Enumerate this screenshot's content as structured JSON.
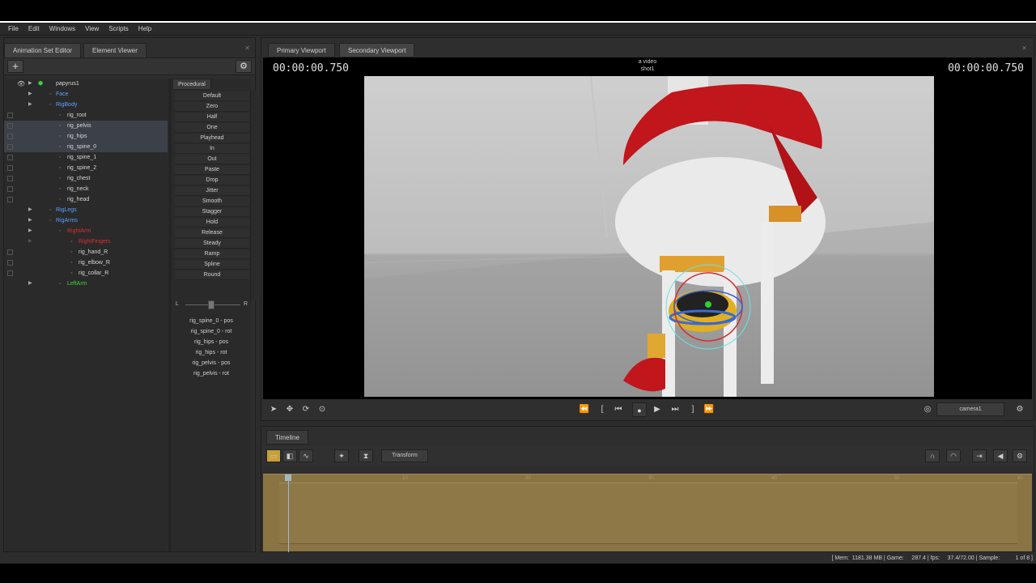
{
  "menu": [
    "File",
    "Edit",
    "Windows",
    "View",
    "Scripts",
    "Help"
  ],
  "left_tabs": [
    "Animation Set Editor",
    "Element Viewer"
  ],
  "tree": [
    {
      "label": "papyrus1",
      "color": "#d6d6d6"
    },
    {
      "label": "Face",
      "color": "#5aa0ff"
    },
    {
      "label": "RigBody",
      "color": "#5aa0ff"
    },
    {
      "label": "rig_root",
      "color": "#d6d6d6"
    },
    {
      "label": "rig_pelvis",
      "color": "#d6d6d6"
    },
    {
      "label": "rig_hips",
      "color": "#d6d6d6"
    },
    {
      "label": "rig_spine_0",
      "color": "#d6d6d6"
    },
    {
      "label": "rig_spine_1",
      "color": "#d6d6d6"
    },
    {
      "label": "rig_spine_2",
      "color": "#d6d6d6"
    },
    {
      "label": "rig_chest",
      "color": "#d6d6d6"
    },
    {
      "label": "rig_neck",
      "color": "#d6d6d6"
    },
    {
      "label": "rig_head",
      "color": "#d6d6d6"
    },
    {
      "label": "RigLegs",
      "color": "#5aa0ff"
    },
    {
      "label": "RigArms",
      "color": "#5aa0ff"
    },
    {
      "label": "RightArm",
      "color": "#d83030"
    },
    {
      "label": "RightFingers",
      "color": "#d83030"
    },
    {
      "label": "rig_hand_R",
      "color": "#d6d6d6"
    },
    {
      "label": "rig_elbow_R",
      "color": "#d6d6d6"
    },
    {
      "label": "rig_collar_R",
      "color": "#d6d6d6"
    },
    {
      "label": "LeftArm",
      "color": "#40d040"
    }
  ],
  "procedural": {
    "tab": "Procedural",
    "buttons": [
      "Default",
      "Zero",
      "Half",
      "One",
      "Playhead",
      "In",
      "Out",
      "Paste",
      "Drop",
      "Jitter",
      "Smooth",
      "Stagger",
      "Hold",
      "Release",
      "Steady",
      "Ramp",
      "Spline",
      "Round"
    ],
    "slider_left": "L",
    "slider_right": "R",
    "channels": [
      "rig_spine_0 - pos",
      "rig_spine_0 - rot",
      "rig_hips - pos",
      "rig_hips - rot",
      "rig_pelvis - pos",
      "rig_pelvis - rot"
    ]
  },
  "viewport": {
    "tabs": [
      "Primary Viewport",
      "Secondary Viewport"
    ],
    "timecode_left": "00:00:00.750",
    "timecode_right": "00:00:00.750",
    "title_line1": "a video",
    "title_line2": "shot1",
    "camera": "camera1"
  },
  "timeline": {
    "tab": "Timeline",
    "transform_label": "Transform",
    "ticks": [
      "10",
      "20",
      "30",
      "40",
      "50",
      "60"
    ]
  },
  "status": "[ Mem:  1181.38 MB | Game:     287.4 | fps:     37.4/72.00 | Sample:          1 of 8 ]"
}
